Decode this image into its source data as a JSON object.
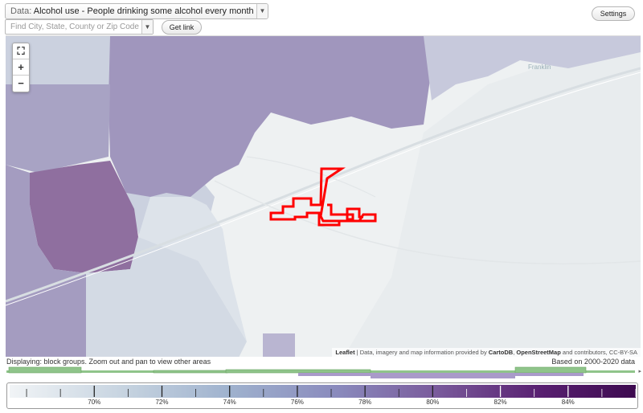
{
  "header": {
    "data_label": "Data:",
    "data_value": "Alcohol use - People drinking some alcohol every month (%)",
    "search_placeholder": "Find City, State, County or Zip Code",
    "get_link_label": "Get link",
    "settings_label": "Settings",
    "dropdown_icon": "chevron-down-icon"
  },
  "map": {
    "zoom_controls": [
      {
        "name": "fullscreen-button",
        "symbol": "⛶",
        "icon": "fullscreen-icon"
      },
      {
        "name": "zoom-in-button",
        "symbol": "+",
        "icon": "plus-icon"
      },
      {
        "name": "zoom-out-button",
        "symbol": "−",
        "icon": "minus-icon"
      }
    ],
    "place_label": "Franklin",
    "attribution_leaflet": "Leaflet",
    "attribution_text": " | Data, imagery and map information provided by ",
    "attribution_cartodb": "CartoDB",
    "attribution_sep": ", ",
    "attribution_osm": "OpenStreetMap",
    "attribution_tail": " and contributors, CC-BY-SA",
    "colors": {
      "light": "#eef1f2",
      "pale_blue": "#d6dde6",
      "blue_grey": "#bcc5d8",
      "lavender": "#aaa6c8",
      "purple": "#9b88b1",
      "dark_purple": "#8d6d9f",
      "highlight_outline": "#ff0000"
    }
  },
  "status": {
    "left": "Displaying: block groups. Zoom out and pan to view other areas",
    "right": "Based on 2000-2020 data",
    "histogram_arrow": "▸"
  },
  "legend": {
    "ticks": [
      "70%",
      "72%",
      "74%",
      "76%",
      "78%",
      "80%",
      "82%",
      "84%"
    ],
    "tick_values": [
      70,
      72,
      74,
      76,
      78,
      80,
      82,
      84
    ],
    "range": [
      67.5,
      86
    ],
    "gradient_colors": [
      "#f1f4f6",
      "#c2d0de",
      "#9fb2ce",
      "#8a8bbd",
      "#7a5b9c",
      "#581f70",
      "#3d0a4f"
    ],
    "histogram_colors": {
      "green": "#8fc48a",
      "purple": "#a99ac9"
    }
  }
}
